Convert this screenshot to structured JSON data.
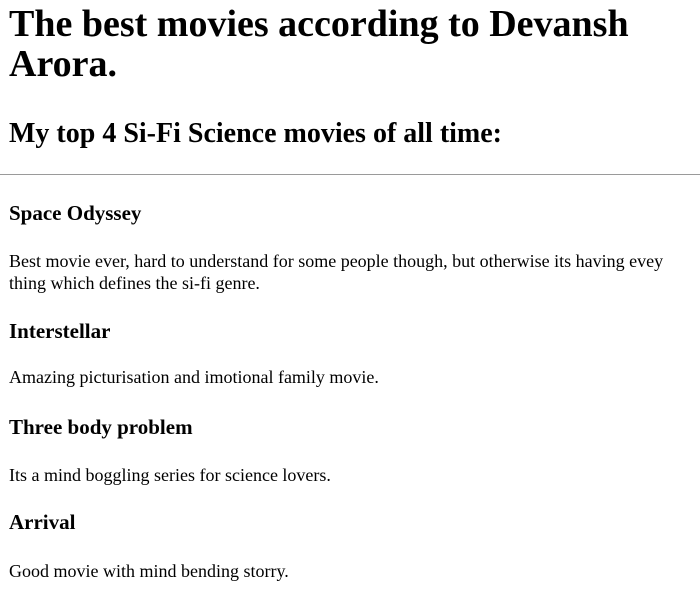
{
  "page": {
    "title": "The best movies according to Devansh Arora.",
    "subtitle": "My top 4 Si-Fi Science movies of all time:"
  },
  "movies": [
    {
      "name": "Space Odyssey",
      "description": "Best movie ever, hard to understand for some people though, but otherwise its having evey thing which defines the si-fi genre."
    },
    {
      "name": "Interstellar",
      "description": "Amazing picturisation and imotional family movie."
    },
    {
      "name": "Three body problem",
      "description": "Its a mind boggling series for science lovers."
    },
    {
      "name": "Arrival",
      "description": "Good movie with mind bending storry."
    }
  ]
}
